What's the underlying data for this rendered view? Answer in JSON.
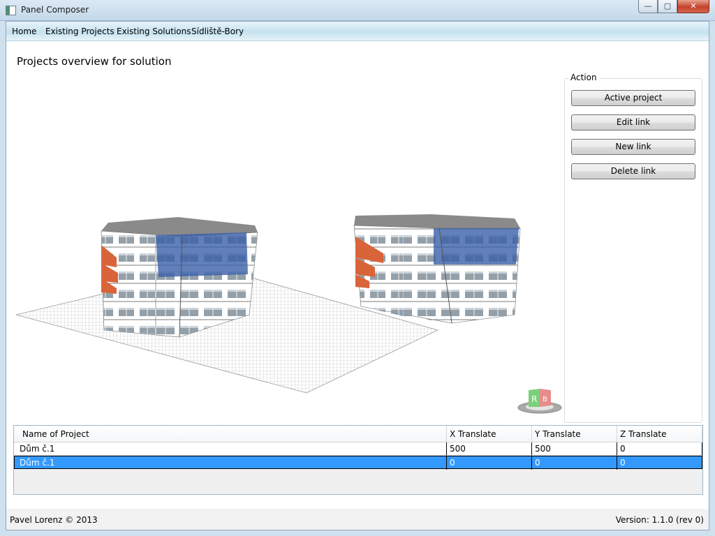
{
  "window": {
    "title": "Panel Composer",
    "minimize_glyph": "—",
    "maximize_glyph": "▢",
    "close_glyph": "✕"
  },
  "menu": [
    "Home",
    "Existing Projects",
    "Existing Solutions",
    "Sídliště-Bory"
  ],
  "page_title": "Projects overview for solution",
  "action": {
    "label": "Action",
    "buttons": [
      "Active project",
      "Edit link",
      "New link",
      "Delete link"
    ]
  },
  "grid": {
    "columns": [
      "Name of Project",
      "X Translate",
      "Y Translate",
      "Z Translate"
    ],
    "rows": [
      [
        "Dům č.1",
        "500",
        "500",
        "0"
      ],
      [
        "Dům č.1",
        "0",
        "0",
        "0"
      ]
    ],
    "selected_row": 1
  },
  "viewcube": {
    "faces": [
      "R",
      "B"
    ]
  },
  "status": {
    "left": "Pavel Lorenz © 2013",
    "right": "Version: 1.1.0 (rev 0)"
  },
  "colors": {
    "selection": "#3399ff",
    "panel_blue": "#3a5fa8",
    "balcony_orange": "#d9643a",
    "roof": "#8e8e8e"
  }
}
